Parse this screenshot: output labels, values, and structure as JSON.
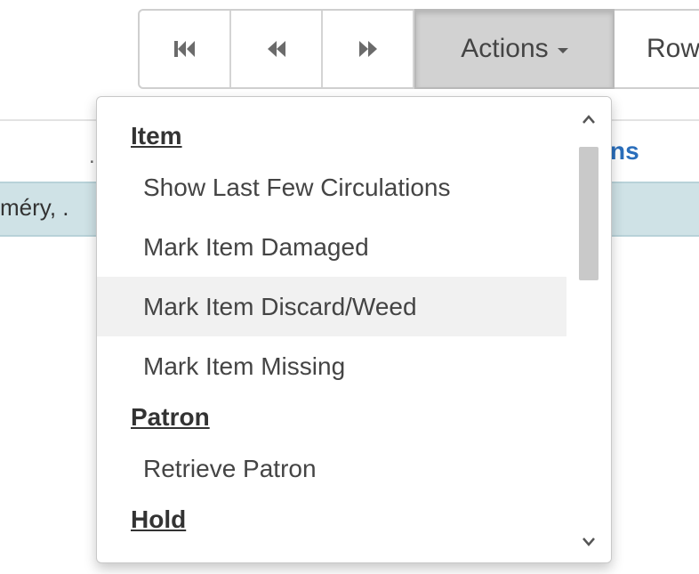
{
  "toolbar": {
    "first_icon": "first-page-icon",
    "prev_icon": "previous-page-icon",
    "next_icon": "next-page-icon",
    "actions_label": "Actions",
    "rows_label": "Row"
  },
  "background": {
    "column_header_fragment": "ns",
    "column_header_dot": ".",
    "row_text_fragment": "méry, ."
  },
  "actions_menu": {
    "sections": [
      {
        "header": "Item",
        "items": [
          "Show Last Few Circulations",
          "Mark Item Damaged",
          "Mark Item Discard/Weed",
          "Mark Item Missing"
        ]
      },
      {
        "header": "Patron",
        "items": [
          "Retrieve Patron"
        ]
      },
      {
        "header": "Hold",
        "items": []
      }
    ],
    "hovered_item": "Mark Item Discard/Weed",
    "scroll_up_icon": "chevron-up-icon",
    "scroll_down_icon": "chevron-down-icon"
  },
  "colors": {
    "link_blue": "#2a6ebb",
    "selected_row": "#cfe2e6",
    "active_button": "#d2d2d2"
  }
}
